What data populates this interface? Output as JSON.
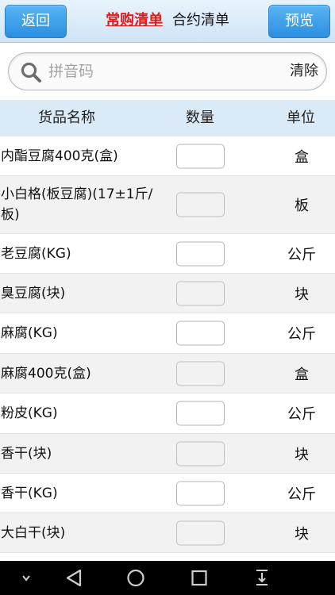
{
  "header": {
    "back_label": "返回",
    "tab_active": "常购清单",
    "tab_inactive": "合约清单",
    "preview_label": "预览"
  },
  "search": {
    "placeholder": "拼音码",
    "value": "",
    "icon": "search-icon",
    "clear_label": "清除"
  },
  "table": {
    "columns": [
      "货品名称",
      "数量",
      "单位"
    ],
    "rows": [
      {
        "name": "内酯豆腐400克(盒)",
        "qty": "",
        "unit": "盒"
      },
      {
        "name": "小白格(板豆腐)(17±1斤/板)",
        "qty": "",
        "unit": "板"
      },
      {
        "name": "老豆腐(KG)",
        "qty": "",
        "unit": "公斤"
      },
      {
        "name": "臭豆腐(块)",
        "qty": "",
        "unit": "块"
      },
      {
        "name": "麻腐(KG)",
        "qty": "",
        "unit": "公斤"
      },
      {
        "name": "麻腐400克(盒)",
        "qty": "",
        "unit": "盒"
      },
      {
        "name": "粉皮(KG)",
        "qty": "",
        "unit": "公斤"
      },
      {
        "name": "香干(块)",
        "qty": "",
        "unit": "块"
      },
      {
        "name": "香干(KG)",
        "qty": "",
        "unit": "公斤"
      },
      {
        "name": "大白干(块)",
        "qty": "",
        "unit": "块"
      }
    ]
  },
  "navbar": {
    "icons": [
      "chevron-down-icon",
      "back-triangle-icon",
      "home-circle-icon",
      "recents-square-icon",
      "notification-pull-icon"
    ]
  },
  "colors": {
    "accent": "#2b8fe0",
    "active_tab": "#e21b1b",
    "header_row": "#dbeaf7",
    "alt_row": "#f2f2f2"
  }
}
